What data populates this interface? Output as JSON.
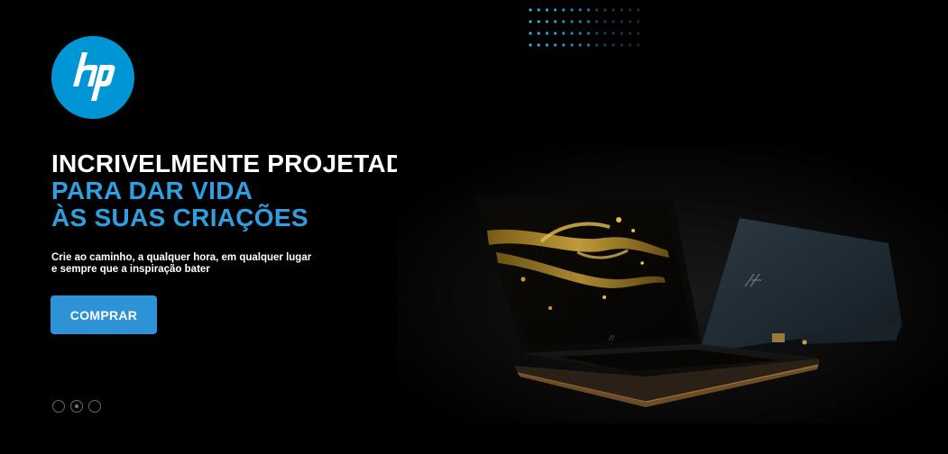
{
  "brand": {
    "name": "hp",
    "color": "#0096d6"
  },
  "hero": {
    "headline_line1": "INCRIVELMENTE PROJETADO",
    "headline_line2": "PARA DAR VIDA",
    "headline_line3": "ÀS SUAS CRIAÇÕES",
    "subtitle_line1": "Crie ao caminho, a qualquer hora, em qualquer lugar",
    "subtitle_line2": "e sempre que a inspiração bater",
    "cta_label": "COMPRAR",
    "accent_color": "#2f9fe0",
    "button_color": "#2e93d6"
  },
  "carousel": {
    "slides": 3,
    "active_index": 1
  },
  "image": {
    "subject": "laptop-product-image"
  }
}
